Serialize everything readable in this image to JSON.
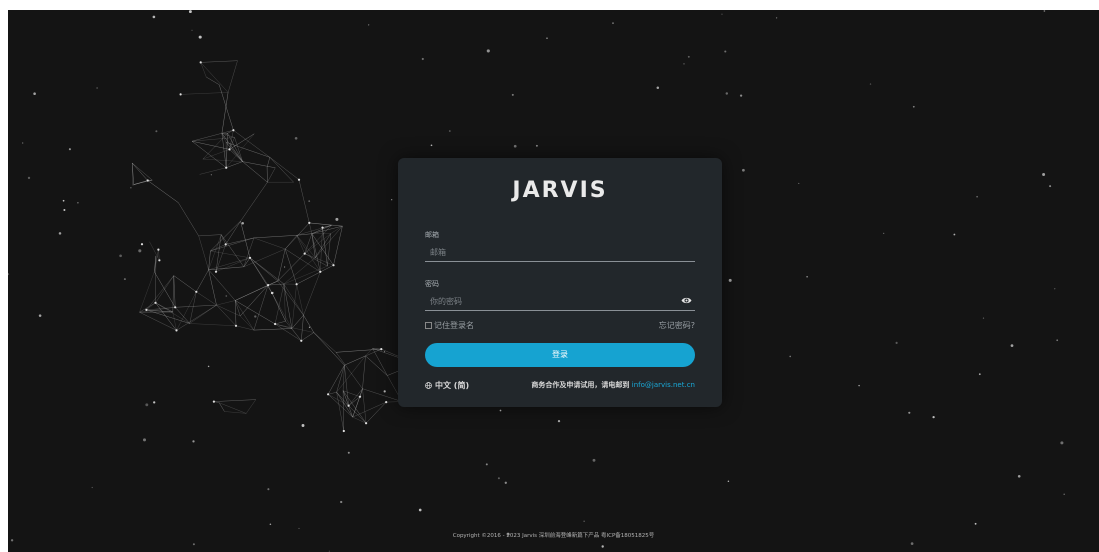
{
  "app": {
    "logo": "JARVIS"
  },
  "login": {
    "email_label": "邮箱",
    "email_placeholder": "邮箱",
    "password_label": "密码",
    "password_placeholder": "你的密码",
    "remember_label": "记住登录名",
    "forgot_label": "忘记密码?",
    "submit_label": "登录"
  },
  "footer": {
    "language_label": "中文 (简)",
    "contact_text": "商务合作及申请试用，请电邮到",
    "contact_email": "info@jarvis.net.cn",
    "copyright": "Copyright ©2016 - 2023 Jarvis 深圳前海登峰新篇下产品 粤ICP备18051825号"
  },
  "colors": {
    "background": "#141414",
    "card": "#22272b",
    "accent": "#16a3d1",
    "link": "#1aa9d8"
  },
  "icons": {
    "password_toggle": "eye-icon",
    "language": "globe-icon"
  }
}
